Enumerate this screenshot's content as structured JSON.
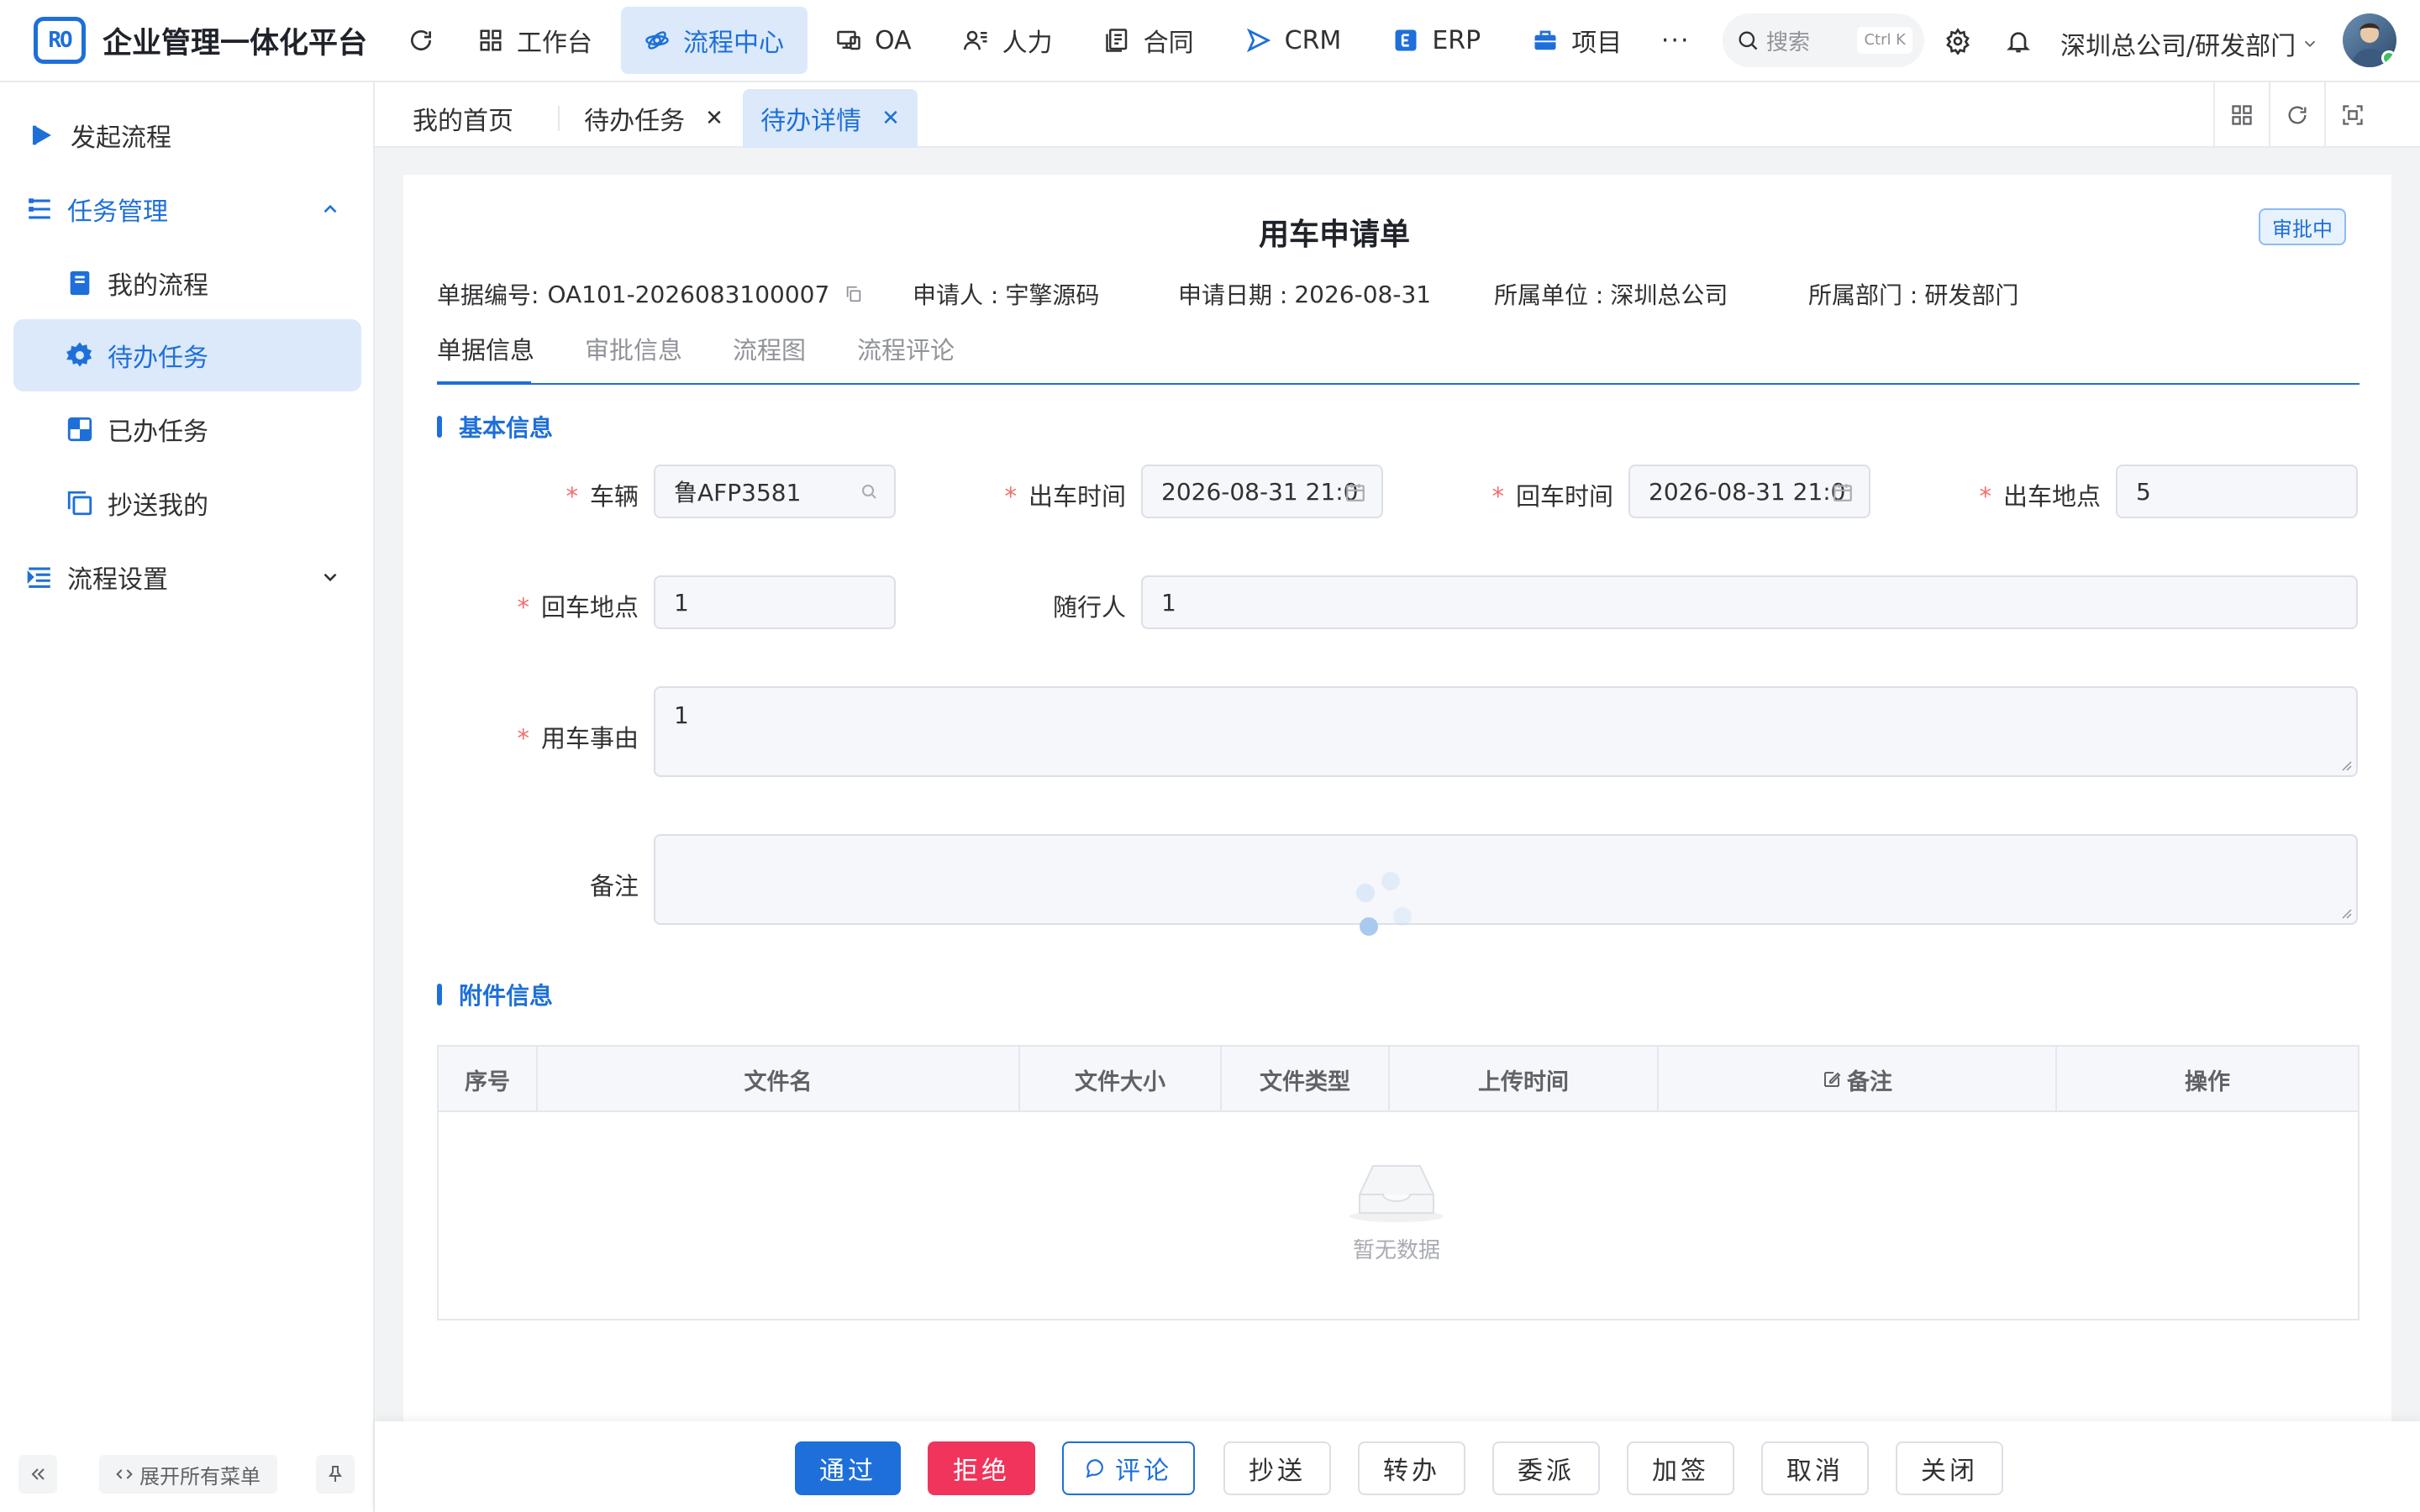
{
  "app": {
    "logo_text": "RO",
    "title": "企业管理一体化平台"
  },
  "nav": [
    {
      "label": "工作台",
      "icon": "grid-icon"
    },
    {
      "label": "流程中心",
      "icon": "workflow-icon"
    },
    {
      "label": "OA",
      "icon": "monitor-icon"
    },
    {
      "label": "人力",
      "icon": "people-icon"
    },
    {
      "label": "合同",
      "icon": "document-icon"
    },
    {
      "label": "CRM",
      "icon": "send-icon"
    },
    {
      "label": "ERP",
      "icon": "erp-icon"
    },
    {
      "label": "项目",
      "icon": "briefcase-icon"
    }
  ],
  "nav_more": "···",
  "search": {
    "placeholder": "搜索",
    "shortcut": "Ctrl K"
  },
  "org": "深圳总公司/研发部门",
  "sidebar": {
    "items": [
      {
        "label": "发起流程"
      },
      {
        "label": "任务管理"
      },
      {
        "label": "我的流程"
      },
      {
        "label": "待办任务"
      },
      {
        "label": "已办任务"
      },
      {
        "label": "抄送我的"
      },
      {
        "label": "流程设置"
      }
    ],
    "expand_all": "展开所有菜单"
  },
  "tabs": [
    {
      "label": "我的首页"
    },
    {
      "label": "待办任务"
    },
    {
      "label": "待办详情"
    }
  ],
  "form": {
    "title": "用车申请单",
    "status": "审批中",
    "doc_no_label": "单据编号:",
    "doc_no": "OA101-2026083100007",
    "applicant_label": "申请人 :",
    "applicant": "宇擎源码",
    "date_label": "申请日期 :",
    "date": "2026-08-31",
    "unit_label": "所属单位 :",
    "unit": "深圳总公司",
    "dept_label": "所属部门 :",
    "dept": "研发部门",
    "tabs": [
      "单据信息",
      "审批信息",
      "流程图",
      "流程评论"
    ],
    "section_basic": "基本信息",
    "section_attach": "附件信息",
    "fields": {
      "vehicle": {
        "label": "车辆",
        "value": "鲁AFP3581"
      },
      "depart_time": {
        "label": "出车时间",
        "value": "2026-08-31 21:0"
      },
      "return_time": {
        "label": "回车时间",
        "value": "2026-08-31 21:0"
      },
      "depart_place": {
        "label": "出车地点",
        "value": "5"
      },
      "return_place": {
        "label": "回车地点",
        "value": "1"
      },
      "companion": {
        "label": "随行人",
        "value": "1"
      },
      "reason": {
        "label": "用车事由",
        "value": "1"
      },
      "remark": {
        "label": "备注",
        "value": ""
      }
    },
    "required_mark": "*"
  },
  "attach_table": {
    "columns": [
      "序号",
      "文件名",
      "文件大小",
      "文件类型",
      "上传时间",
      "备注",
      "操作"
    ],
    "rows": [],
    "empty_text": "暂无数据"
  },
  "actions": [
    "通过",
    "拒绝",
    "评论",
    "抄送",
    "转办",
    "委派",
    "加签",
    "取消",
    "关闭"
  ],
  "colors": {
    "primary": "#1e6fd9",
    "danger": "#f0345b",
    "active_bg": "#dbe9fb"
  }
}
